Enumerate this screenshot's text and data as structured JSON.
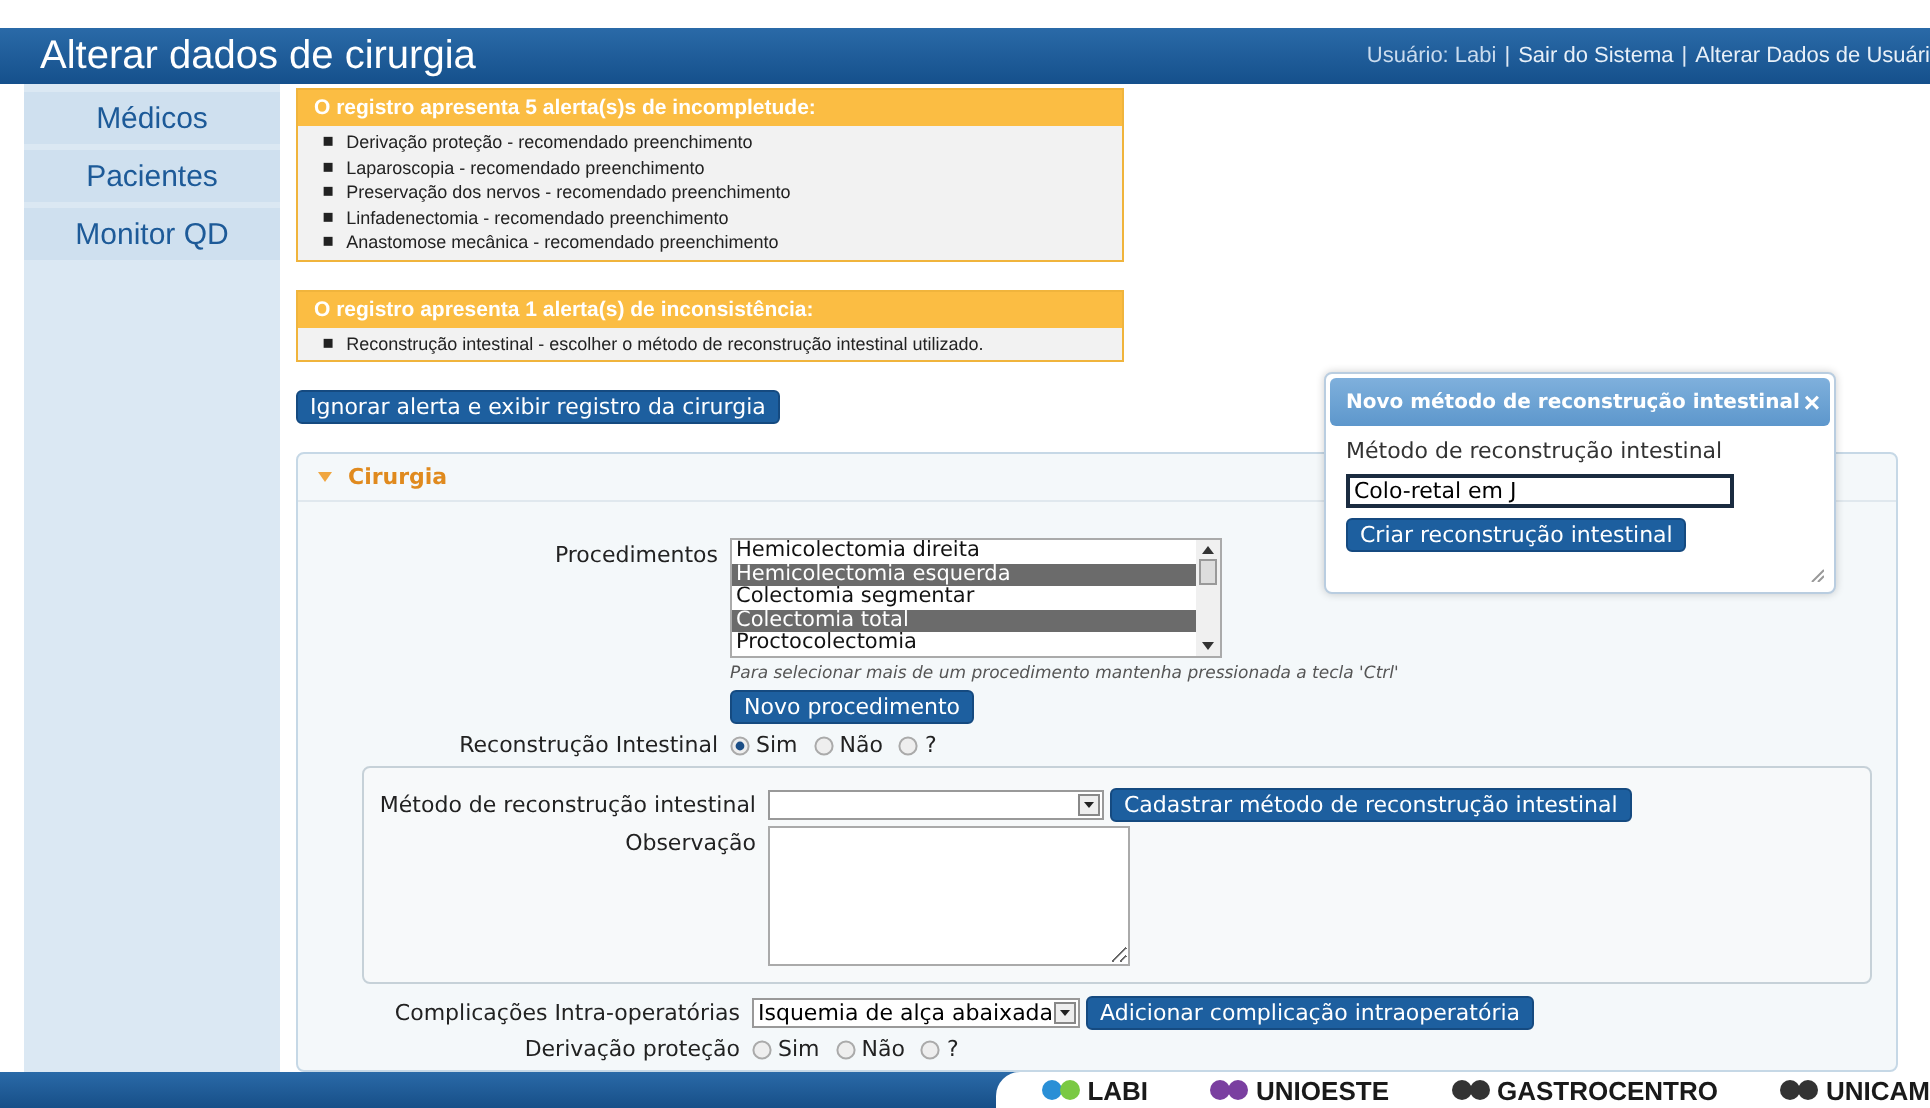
{
  "header": {
    "title": "Alterar dados de cirurgia",
    "separator": "|",
    "user_links": [
      {
        "label": "Usuário: Labi",
        "kind": "text"
      },
      {
        "label": "Sair do Sistema",
        "kind": "link"
      },
      {
        "label": "Alterar Dados de Usuári",
        "kind": "link"
      }
    ]
  },
  "sidebar": {
    "items": [
      {
        "label": "Médicos"
      },
      {
        "label": "Pacientes"
      },
      {
        "label": "Monitor QD"
      }
    ]
  },
  "alert_marker": "▪",
  "alerts": [
    {
      "title": "O registro apresenta 5 alerta(s)s de incompletude:",
      "items": [
        "Derivação proteção - recomendado preenchimento",
        "Laparoscopia - recomendado preenchimento",
        "Preservação dos nervos - recomendado preenchimento",
        "Linfadenectomia - recomendado preenchimento",
        "Anastomose mecânica - recomendado preenchimento"
      ]
    },
    {
      "title": "O registro apresenta 1 alerta(s) de inconsistência:",
      "items": [
        "Reconstrução intestinal - escolher o método de reconstrução intestinal utilizado."
      ]
    }
  ],
  "ignore_button": "Ignorar alerta e exibir registro da cirurgia",
  "section": {
    "title": "Cirurgia",
    "expanded": true,
    "procedures": {
      "label": "Procedimentos",
      "options": [
        {
          "label": "Hemicolectomia direita",
          "selected": false
        },
        {
          "label": "Hemicolectomia esquerda",
          "selected": true
        },
        {
          "label": "Colectomia segmentar",
          "selected": false
        },
        {
          "label": "Colectomia total",
          "selected": true
        },
        {
          "label": "Proctocolectomia",
          "selected": false
        }
      ],
      "hint": "Para selecionar mais de um procedimento mantenha pressionada a tecla 'Ctrl'",
      "button": "Novo procedimento"
    },
    "reconstruction": {
      "label": "Reconstrução Intestinal",
      "options": [
        {
          "label": "Sim",
          "selected": true
        },
        {
          "label": "Não",
          "selected": false
        },
        {
          "label": "?",
          "selected": false
        }
      ]
    },
    "method": {
      "label": "Método de reconstrução intestinal",
      "button": "Cadastrar método de reconstrução intestinal"
    },
    "observation": {
      "label": "Observação"
    },
    "complications": {
      "label": "Complicações Intra-operatórias",
      "value": "Isquemia de alça abaixada",
      "button": "Adicionar complicação intraoperatória"
    },
    "derivation": {
      "label": "Derivação proteção",
      "options": [
        {
          "label": "Sim",
          "selected": false
        },
        {
          "label": "Não",
          "selected": false
        },
        {
          "label": "?",
          "selected": false
        }
      ]
    }
  },
  "dialog": {
    "title": "Novo método de reconstrução intestinal",
    "close": "×",
    "field_label": "Método de reconstrução intestinal",
    "value": "Colo-retal em J",
    "button": "Criar reconstrução intestinal"
  },
  "footer": {
    "logos": [
      "LABI",
      "UNIOESTE",
      "GASTROCENTRO",
      "UNICAM"
    ]
  }
}
